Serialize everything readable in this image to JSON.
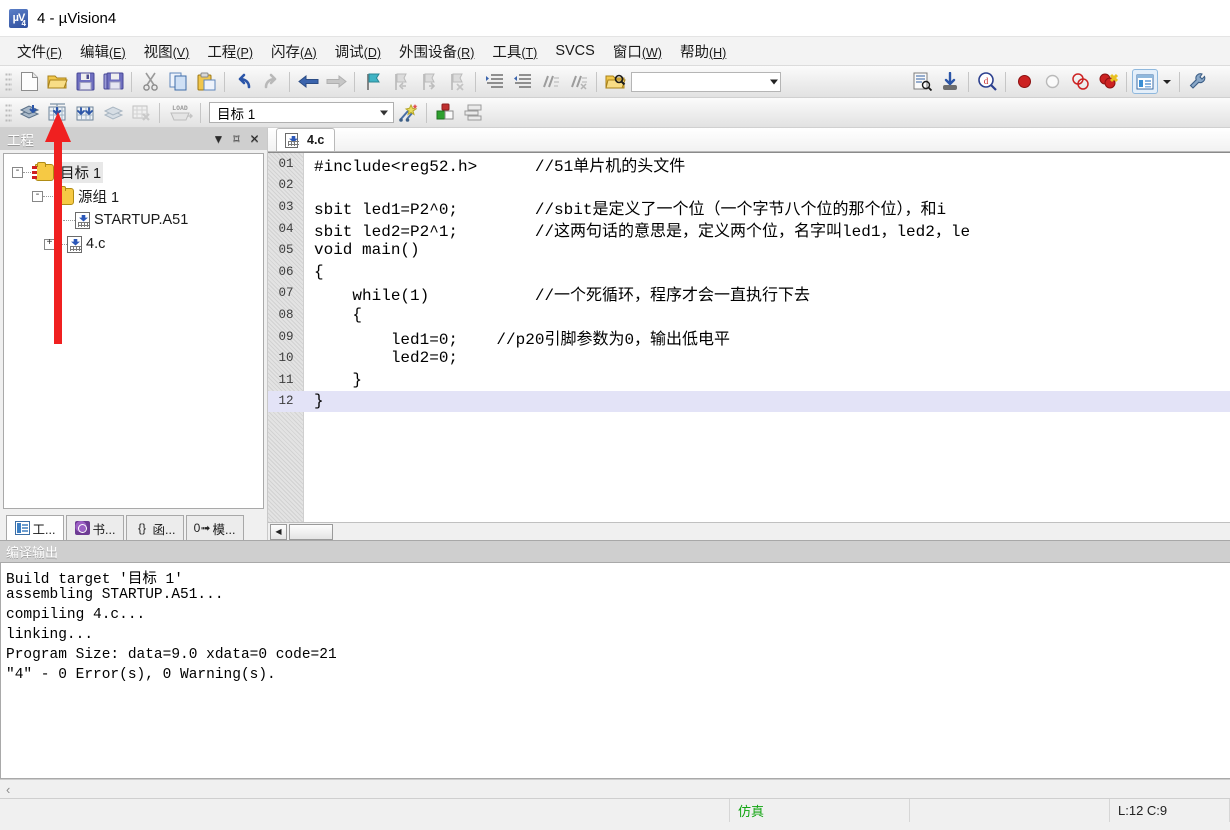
{
  "window": {
    "title": "4  - µVision4",
    "app_icon": "uvision-logo-icon"
  },
  "menubar": [
    {
      "label": "文件",
      "accel": "(F)"
    },
    {
      "label": "编辑",
      "accel": "(E)"
    },
    {
      "label": "视图",
      "accel": "(V)"
    },
    {
      "label": "工程",
      "accel": "(P)"
    },
    {
      "label": "闪存",
      "accel": "(A)"
    },
    {
      "label": "调试",
      "accel": "(D)"
    },
    {
      "label": "外围设备",
      "accel": "(R)"
    },
    {
      "label": "工具",
      "accel": "(T)"
    },
    {
      "label": "SVCS",
      "accel": ""
    },
    {
      "label": "窗口",
      "accel": "(W)"
    },
    {
      "label": "帮助",
      "accel": "(H)"
    }
  ],
  "toolbar_main": {
    "find_placeholder": "",
    "find_value": "",
    "buttons": [
      "new-file-icon",
      "open-file-icon",
      "save-icon",
      "save-all-icon",
      "cut-icon",
      "copy-icon",
      "paste-icon",
      "undo-icon",
      "redo-icon",
      "back-icon",
      "forward-icon",
      "bookmark-toggle-icon",
      "bookmark-prev-icon",
      "bookmark-next-icon",
      "bookmark-clear-icon",
      "indent-icon",
      "outdent-icon",
      "comment-icon",
      "uncomment-icon",
      "find-in-files-icon",
      "configure-icon",
      "debug-start-icon",
      "insert-watch-icon",
      "breakpoint-icon",
      "breakpoint-disable-icon",
      "breakpoint-disable-all-icon",
      "breakpoint-kill-all-icon",
      "project-window-icon",
      "project-window-dropdown-icon",
      "configure-wizard-icon"
    ]
  },
  "toolbar_build": {
    "target_value": "目标 1",
    "buttons": [
      "translate-icon",
      "build-target-icon",
      "rebuild-all-icon",
      "batch-build-icon",
      "stop-build-icon",
      "download-icon",
      "target-options-icon",
      "manage-components-icon",
      "manage-multi-project-icon"
    ]
  },
  "project_panel": {
    "title": "工程",
    "title_buttons": [
      "chevron-down-icon",
      "pin-icon",
      "close-icon"
    ],
    "tree": [
      {
        "label": "目标 1",
        "indent": 0,
        "expander": "-",
        "icon": "target-folder-icon",
        "selected": true
      },
      {
        "label": "源组 1",
        "indent": 1,
        "expander": "-",
        "icon": "folder-icon",
        "selected": false
      },
      {
        "label": "STARTUP.A51",
        "indent": 2,
        "expander": "",
        "icon": "source-file-icon",
        "selected": false
      },
      {
        "label": "4.c",
        "indent": 1.6,
        "expander": "+",
        "icon": "source-file-icon",
        "selected": false
      }
    ],
    "tabs": [
      {
        "label": "工...",
        "icon": "project-window-icon",
        "active": true
      },
      {
        "label": "书...",
        "icon": "books-icon",
        "active": false
      },
      {
        "label": "函...",
        "icon": "functions-braces-icon",
        "active": false
      },
      {
        "label": "模...",
        "icon": "templates-icon",
        "active": false
      }
    ]
  },
  "editor": {
    "tabs": [
      {
        "label": "4.c",
        "icon": "source-file-icon",
        "active": true
      }
    ],
    "lines": [
      {
        "no": "01",
        "text": "#include<reg52.h>      //51单片机的头文件"
      },
      {
        "no": "02",
        "text": ""
      },
      {
        "no": "03",
        "text": "sbit led1=P2^0;        //sbit是定义了一个位（一个字节八个位的那个位），和i"
      },
      {
        "no": "04",
        "text": "sbit led2=P2^1;        //这两句话的意思是，定义两个位，名字叫led1，led2，le"
      },
      {
        "no": "05",
        "text": "void main()"
      },
      {
        "no": "06",
        "text": "{"
      },
      {
        "no": "07",
        "text": "    while(1)           //一个死循环，程序才会一直执行下去"
      },
      {
        "no": "08",
        "text": "    {"
      },
      {
        "no": "09",
        "text": "        led1=0;    //p20引脚参数为0，输出低电平"
      },
      {
        "no": "10",
        "text": "        led2=0;"
      },
      {
        "no": "11",
        "text": "    }"
      },
      {
        "no": "12",
        "text": "}",
        "highlighted": true
      }
    ]
  },
  "output_panel": {
    "title": "编译输出",
    "lines": [
      "Build target '目标 1'",
      "assembling STARTUP.A51...",
      "compiling 4.c...",
      "linking...",
      "Program Size: data=9.0 xdata=0 code=21",
      "\"4\" - 0 Error(s), 0 Warning(s)."
    ]
  },
  "statusbar": {
    "message": "",
    "simulation": "仿真",
    "middle": "",
    "position": "L:12 C:9"
  },
  "annotation": {
    "arrow_color": "#f02020",
    "points_to": "build-target-icon"
  }
}
